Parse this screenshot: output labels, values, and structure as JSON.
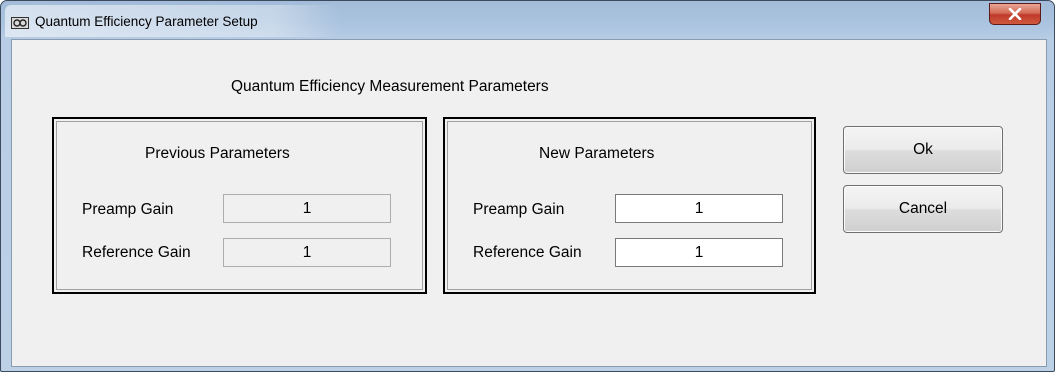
{
  "window": {
    "title": "Quantum Efficiency Parameter Setup",
    "icon": "app-icon",
    "close_symbol": "close-icon"
  },
  "main": {
    "heading": "Quantum Efficiency Measurement Parameters"
  },
  "previous": {
    "title": "Previous  Parameters",
    "preamp_label": "Preamp Gain",
    "preamp_value": "1",
    "reference_label": "Reference Gain",
    "reference_value": "1"
  },
  "new": {
    "title": "New  Parameters",
    "preamp_label": "Preamp Gain",
    "preamp_value": "1",
    "reference_label": "Reference Gain",
    "reference_value": "1"
  },
  "buttons": {
    "ok": "Ok",
    "cancel": "Cancel"
  },
  "colors": {
    "frame": "#a9c2de",
    "client": "#f0f0f0",
    "close": "#c0392b"
  }
}
